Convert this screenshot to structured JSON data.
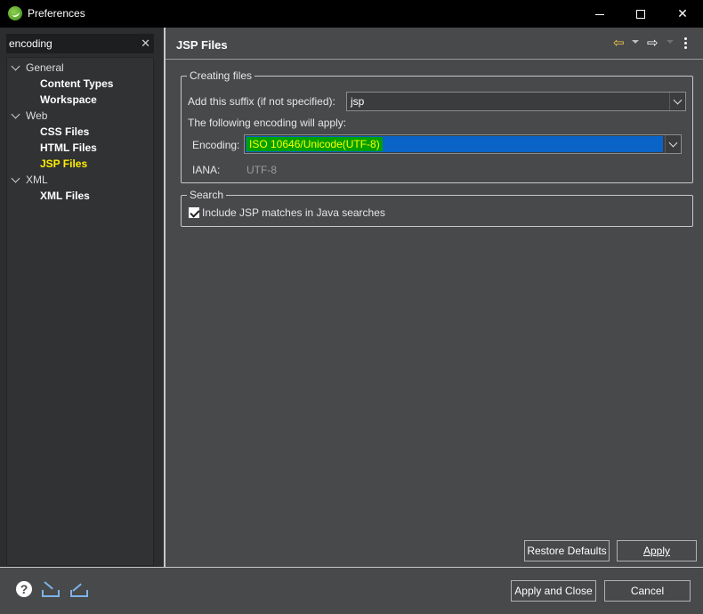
{
  "window": {
    "title": "Preferences",
    "minimize_icon": "minimize-icon",
    "maximize_icon": "maximize-icon",
    "close_glyph": "✕"
  },
  "filter": {
    "value": "encoding",
    "clear_glyph": "✕"
  },
  "tree": {
    "items": [
      {
        "label": "General",
        "level": 0,
        "expanded": true
      },
      {
        "label": "Content Types",
        "level": 1
      },
      {
        "label": "Workspace",
        "level": 1
      },
      {
        "label": "Web",
        "level": 0,
        "expanded": true
      },
      {
        "label": "CSS Files",
        "level": 1
      },
      {
        "label": "HTML Files",
        "level": 1
      },
      {
        "label": "JSP Files",
        "level": 1,
        "selected": true
      },
      {
        "label": "XML",
        "level": 0,
        "expanded": true
      },
      {
        "label": "XML Files",
        "level": 1
      }
    ]
  },
  "page": {
    "title": "JSP Files",
    "back_glyph": "⇦",
    "forward_glyph": "⇨"
  },
  "creating_files": {
    "group_title": "Creating files",
    "suffix_label": "Add this suffix (if not specified):",
    "suffix_value": "jsp",
    "encoding_note": "The following encoding will apply:",
    "encoding_label": "Encoding:",
    "encoding_value": "ISO 10646/Unicode(UTF-8)",
    "iana_label": "IANA:",
    "iana_value": "UTF-8"
  },
  "search": {
    "group_title": "Search",
    "checkbox_label": "Include JSP matches in Java searches",
    "checked": true
  },
  "buttons": {
    "restore_defaults": "Restore Defaults",
    "apply": "Apply",
    "apply_and_close": "Apply and Close",
    "cancel": "Cancel"
  },
  "bottom": {
    "help_glyph": "?"
  },
  "colors": {
    "selected_tree_item": "#ffee00",
    "encoding_highlight": "#0a64c8",
    "encoding_text_bg": "#00a000"
  }
}
